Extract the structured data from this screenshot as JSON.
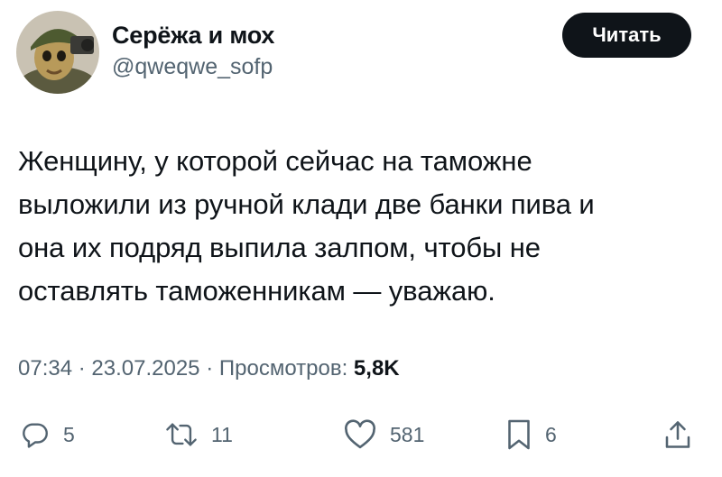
{
  "author": {
    "display_name": "Серёжа и мох",
    "handle": "@qweqwe_sofp"
  },
  "header": {
    "read_button_label": "Читать"
  },
  "tweet": {
    "text_lines": [
      "Женщину, у которой сейчас на таможне",
      "выложили из ручной клади две банки пива и",
      "она их подряд выпила залпом, чтобы не",
      "оставлять таможенникам — уважаю."
    ]
  },
  "meta": {
    "time": "07:34",
    "separator": "·",
    "date": "23.07.2025",
    "views_label": "Просмотров:",
    "views_count": "5,8K"
  },
  "actions": {
    "replies": "5",
    "reposts": "11",
    "likes": "581",
    "bookmarks": "6"
  },
  "icons": {
    "reply": "reply-icon",
    "repost": "repost-icon",
    "like": "heart-icon",
    "bookmark": "bookmark-icon",
    "share": "share-icon"
  },
  "colors": {
    "text_primary": "#0f1419",
    "text_secondary": "#536471",
    "button_bg": "#0f1419",
    "button_text": "#ffffff"
  }
}
